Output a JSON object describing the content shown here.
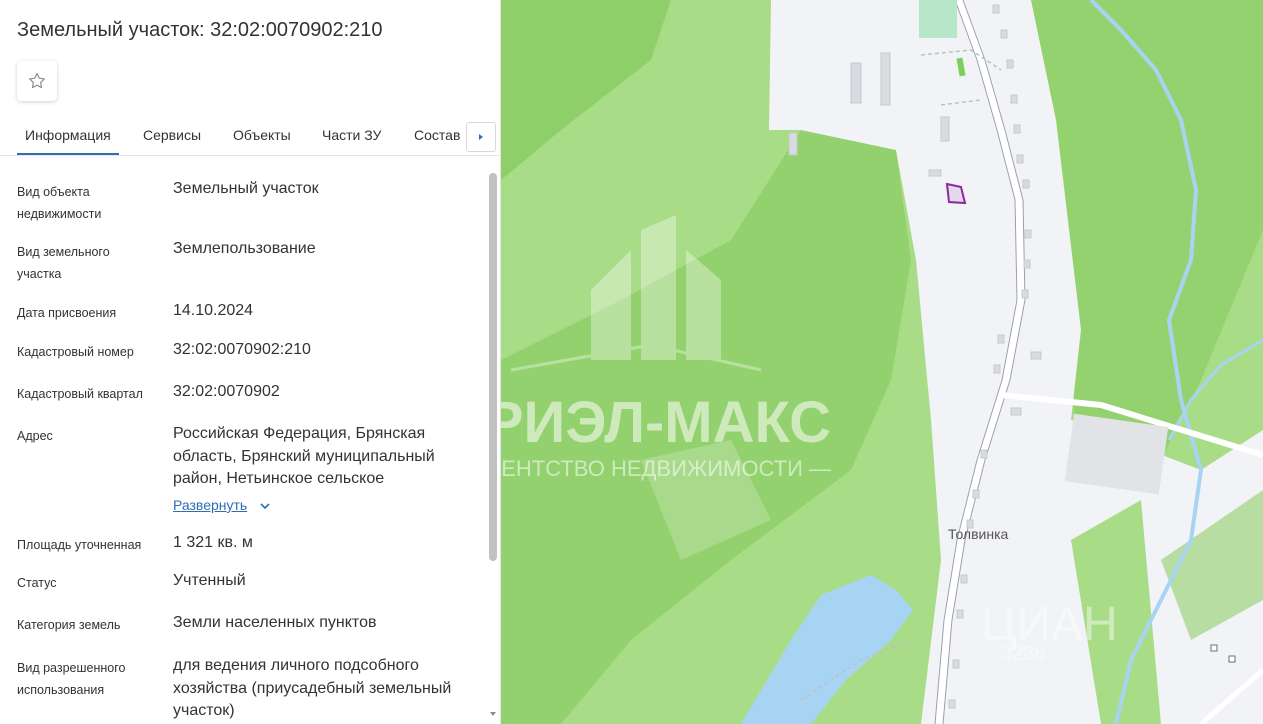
{
  "header": {
    "title": "Земельный участок: 32:02:0070902:210"
  },
  "tabs": [
    {
      "label": "Информация",
      "active": true
    },
    {
      "label": "Сервисы",
      "active": false
    },
    {
      "label": "Объекты",
      "active": false
    },
    {
      "label": "Части ЗУ",
      "active": false
    },
    {
      "label": "Состав",
      "active": false
    }
  ],
  "info": {
    "object_type": {
      "label": "Вид объекта недвижимости",
      "value": "Земельный участок"
    },
    "land_type": {
      "label": "Вид земельного участка",
      "value": "Землепользование"
    },
    "assign_date": {
      "label": "Дата присвоения",
      "value": "14.10.2024"
    },
    "cadastral_number": {
      "label": "Кадастровый номер",
      "value": "32:02:0070902:210"
    },
    "cadastral_quarter": {
      "label": "Кадастровый квартал",
      "value": "32:02:0070902"
    },
    "address": {
      "label": "Адрес",
      "value": "Российская Федерация, Брянская область, Брянский муниципальный район, Нетьинское сельское",
      "expand_label": "Развернуть"
    },
    "area": {
      "label": "Площадь уточненная",
      "value": "1 321 кв. м"
    },
    "status": {
      "label": "Статус",
      "value": "Учтенный"
    },
    "land_category": {
      "label": "Категория земель",
      "value": "Земли населенных пунктов"
    },
    "permitted_use": {
      "label": "Вид разрешенного использования",
      "value": "для ведения личного подсобного хозяйства (приусадебный земельный участок)"
    }
  },
  "map": {
    "place_label": "Толвинка",
    "watermark_main": "РИЭЛ-МАКС",
    "watermark_sub": "— АГЕНТСТВО НЕДВИЖИМОСТИ —",
    "watermark_right": "ЦИАН",
    "watermark_right_sub": "3286",
    "colors": {
      "forest": "#a9dc87",
      "forest_dark": "#8fcf6a",
      "settlement": "#f2f3f6",
      "water": "#a8d4f4",
      "parcel": "#8b2a9c"
    }
  },
  "icons": {
    "favorite": "star-outline-icon",
    "tabs_next": "chevron-right-icon",
    "expand": "chevron-down-icon"
  }
}
